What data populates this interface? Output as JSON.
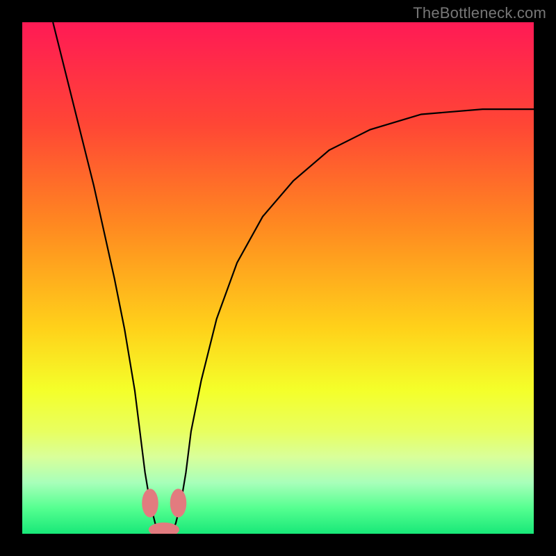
{
  "watermark": "TheBottleneck.com",
  "chart_data": {
    "type": "line",
    "title": "",
    "xlabel": "",
    "ylabel": "",
    "xlim": [
      0,
      100
    ],
    "ylim": [
      0,
      100
    ],
    "grid": false,
    "legend": false,
    "background_gradient_stops": [
      {
        "offset": 0.0,
        "color": "#ff1a55"
      },
      {
        "offset": 0.2,
        "color": "#ff4635"
      },
      {
        "offset": 0.4,
        "color": "#ff8a20"
      },
      {
        "offset": 0.6,
        "color": "#ffd21a"
      },
      {
        "offset": 0.72,
        "color": "#f4ff2a"
      },
      {
        "offset": 0.8,
        "color": "#e8ff60"
      },
      {
        "offset": 0.85,
        "color": "#d9ff9a"
      },
      {
        "offset": 0.9,
        "color": "#a8ffba"
      },
      {
        "offset": 0.95,
        "color": "#55ff90"
      },
      {
        "offset": 1.0,
        "color": "#18e878"
      }
    ],
    "series": [
      {
        "name": "curve",
        "color": "#000000",
        "width": 2.2,
        "x": [
          6,
          8,
          10,
          12,
          14,
          16,
          18,
          20,
          22,
          23,
          24,
          25,
          26,
          27,
          28,
          29,
          30,
          31,
          32,
          33,
          35,
          38,
          42,
          47,
          53,
          60,
          68,
          78,
          90,
          100
        ],
        "y": [
          100,
          92,
          84,
          76,
          68,
          59,
          50,
          40,
          28,
          20,
          12,
          6,
          2,
          0,
          0,
          0,
          2,
          6,
          12,
          20,
          30,
          42,
          53,
          62,
          69,
          75,
          79,
          82,
          83,
          83
        ]
      }
    ],
    "markers": [
      {
        "name": "valley-left",
        "x": 25.0,
        "y": 6.0,
        "rx": 1.6,
        "ry": 2.8,
        "color": "#e27b7f"
      },
      {
        "name": "valley-right",
        "x": 30.5,
        "y": 6.0,
        "rx": 1.6,
        "ry": 2.8,
        "color": "#e27b7f"
      },
      {
        "name": "valley-bottom",
        "x": 27.7,
        "y": 0.8,
        "rx": 3.0,
        "ry": 1.4,
        "color": "#e27b7f"
      }
    ]
  }
}
